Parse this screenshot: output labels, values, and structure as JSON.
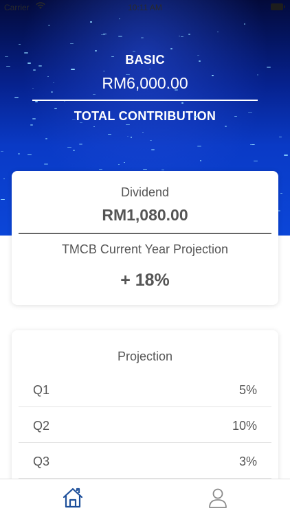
{
  "status_bar": {
    "carrier": "Carrier",
    "time": "10:11 AM"
  },
  "header": {
    "basic_label": "BASIC",
    "basic_amount": "RM6,000.00",
    "total_label": "TOTAL CONTRIBUTION"
  },
  "dividend_card": {
    "label": "Dividend",
    "amount": "RM1,080.00",
    "projection_title": "TMCB Current Year Projection",
    "projection_value": "+ 18%"
  },
  "projection_card": {
    "title": "Projection",
    "rows": [
      {
        "quarter": "Q1",
        "value": "5%"
      },
      {
        "quarter": "Q2",
        "value": "10%"
      },
      {
        "quarter": "Q3",
        "value": "3%"
      }
    ]
  },
  "tab_bar": {
    "tabs": [
      {
        "icon": "home-icon",
        "active": true
      },
      {
        "icon": "profile-icon",
        "active": false
      }
    ],
    "active_color": "#1d4f9a",
    "inactive_color": "#8a8a8a"
  },
  "colors": {
    "hero_gradient_top": "#030a3a",
    "hero_gradient_bottom": "#0b46d8",
    "text_gray": "#555555"
  }
}
